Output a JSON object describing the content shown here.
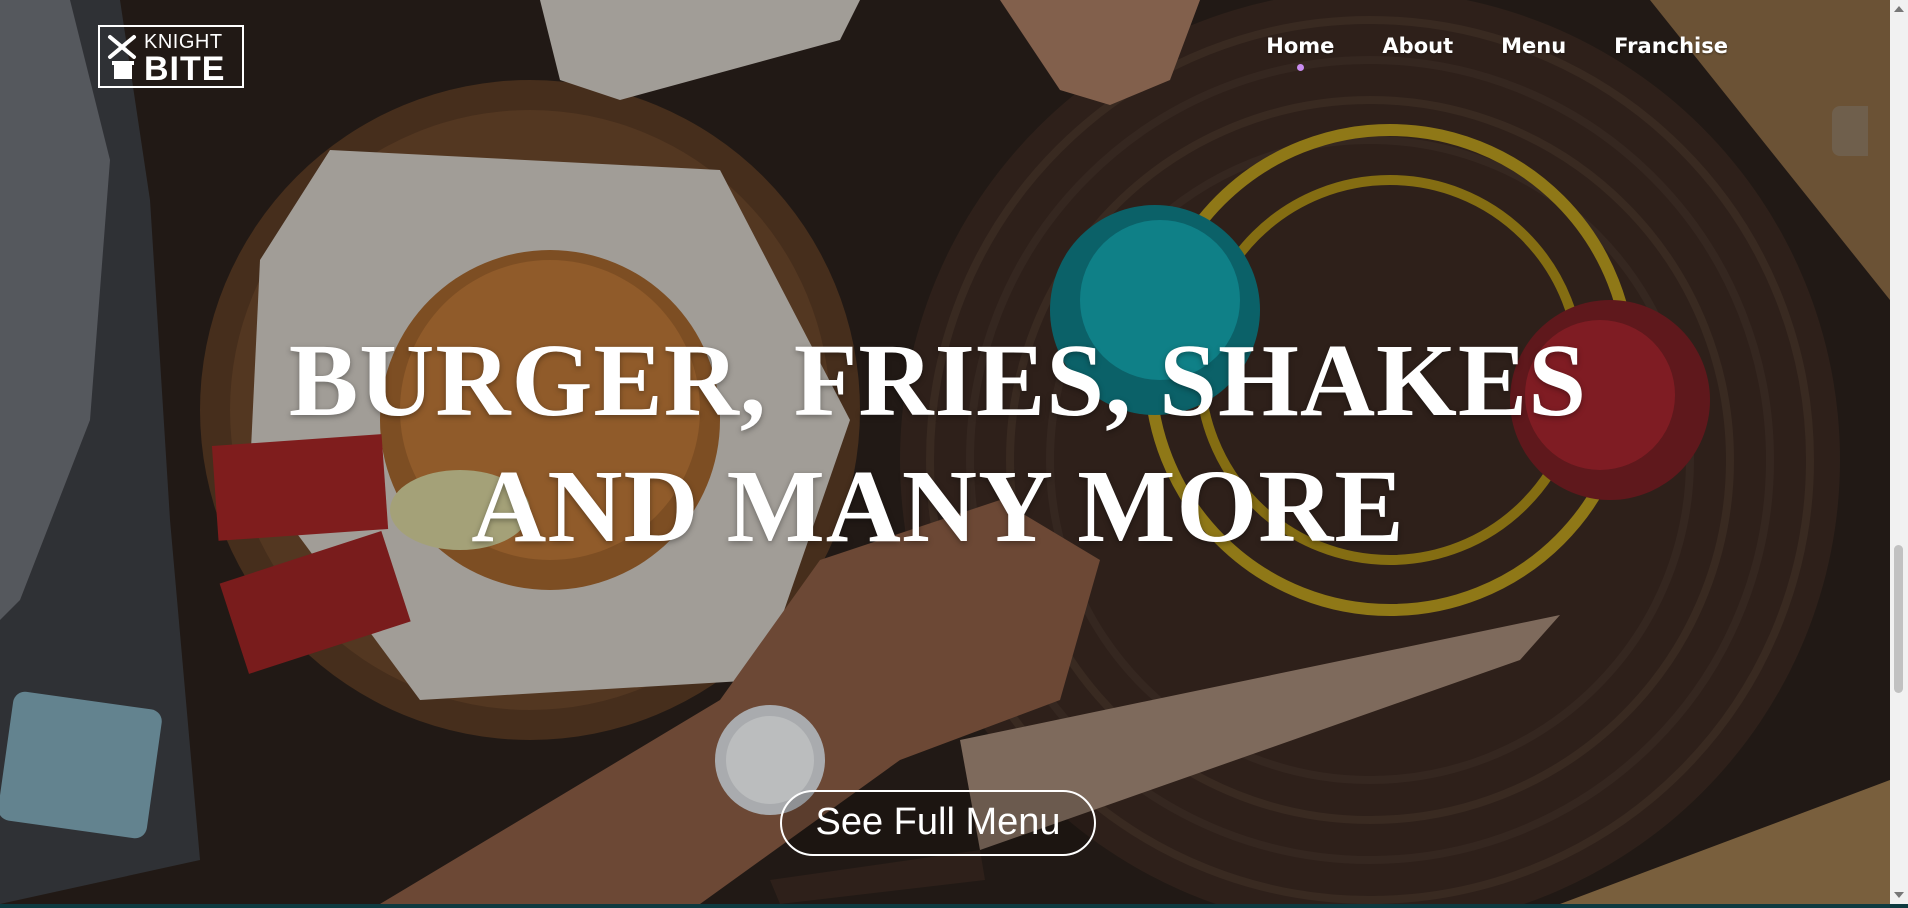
{
  "brand": {
    "logo_top": "KNIGHT",
    "logo_bottom": "BITE"
  },
  "nav": {
    "items": [
      {
        "label": "Home",
        "active": true
      },
      {
        "label": "About",
        "active": false
      },
      {
        "label": "Menu",
        "active": false
      },
      {
        "label": "Franchise",
        "active": false
      }
    ],
    "active_indicator_color": "#c98cf0"
  },
  "hero": {
    "headline_line1": "BURGER, FRIES, SHAKES",
    "headline_line2": "AND MANY MORE",
    "cta_label": "See Full Menu"
  },
  "icons": {
    "logo_mark": "fork-knife-cup-icon",
    "side_widget": "scroll-widget-icon"
  }
}
